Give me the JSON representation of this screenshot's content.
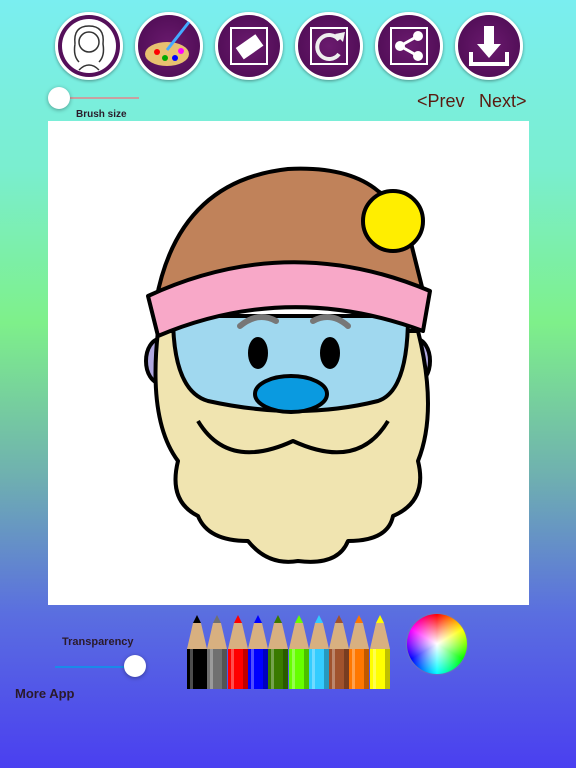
{
  "toolbar": {
    "buttons": [
      {
        "name": "gallery-button",
        "icon": "girl-portrait-icon"
      },
      {
        "name": "palette-button",
        "icon": "palette-brush-icon"
      },
      {
        "name": "eraser-button",
        "icon": "eraser-icon"
      },
      {
        "name": "reset-button",
        "icon": "refresh-icon"
      },
      {
        "name": "share-button",
        "icon": "share-icon"
      },
      {
        "name": "download-button",
        "icon": "download-icon"
      }
    ],
    "button_color": "#4a0a50"
  },
  "brush": {
    "label": "Brush size",
    "value_percent": 5
  },
  "nav": {
    "prev": "<Prev",
    "next": "Next>"
  },
  "transparency": {
    "label": "Transparency",
    "value_percent": 100
  },
  "more_app": "More App",
  "pencils": [
    "#000000",
    "#707070",
    "#ff0000",
    "#0000ff",
    "#3a7a00",
    "#66ff00",
    "#33ccff",
    "#a0522d",
    "#ff7700",
    "#ffff00"
  ],
  "drawing": {
    "hat": "#c0825a",
    "hat_band": "#f8a8c8",
    "pompom": "#ffee00",
    "face": "#a0d8ef",
    "nose": "#0a9ae0",
    "beard": "#f0e4b0",
    "ears": "#b0a8e0"
  }
}
